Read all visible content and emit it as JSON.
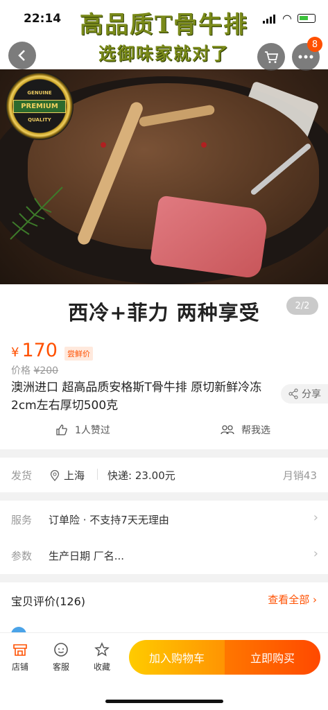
{
  "status_bar": {
    "time": "22:14"
  },
  "hero": {
    "headline_1": "高品质T骨牛排",
    "headline_2": "选御味家就对了",
    "caption": "西冷+菲力 两种享受",
    "page_indicator": "2/2",
    "cart_badge": "8",
    "seal": {
      "top": "GENUINE",
      "ribbon": "PREMIUM",
      "bottom": "QUALITY"
    }
  },
  "product": {
    "currency": "¥",
    "price": "170",
    "price_tag": "尝鲜价",
    "original_label": "价格",
    "original_price": "¥200",
    "title": "澳洲进口 超高品质安格斯T骨牛排 原切新鲜冷冻 2cm左右厚切500克",
    "share_label": "分享",
    "likes": "1人赞过",
    "help_choose": "帮我选"
  },
  "shipping": {
    "label": "发货",
    "location": "上海",
    "fee": "快递: 23.00元",
    "monthly_sales": "月销43"
  },
  "service": {
    "rows": [
      {
        "label": "服务",
        "value": "订单险 · 不支持7天无理由"
      },
      {
        "label": "参数",
        "value": "生产日期 厂名..."
      }
    ]
  },
  "reviews": {
    "title": "宝贝评价(126)",
    "view_all": "查看全部"
  },
  "bottom_bar": {
    "shop": "店铺",
    "service": "客服",
    "favorite": "收藏",
    "add_to_cart": "加入购物车",
    "buy_now": "立即购买"
  },
  "colors": {
    "accent": "#ff5000",
    "cart_button": "#ffb000",
    "buy_button": "#ff5a00"
  }
}
